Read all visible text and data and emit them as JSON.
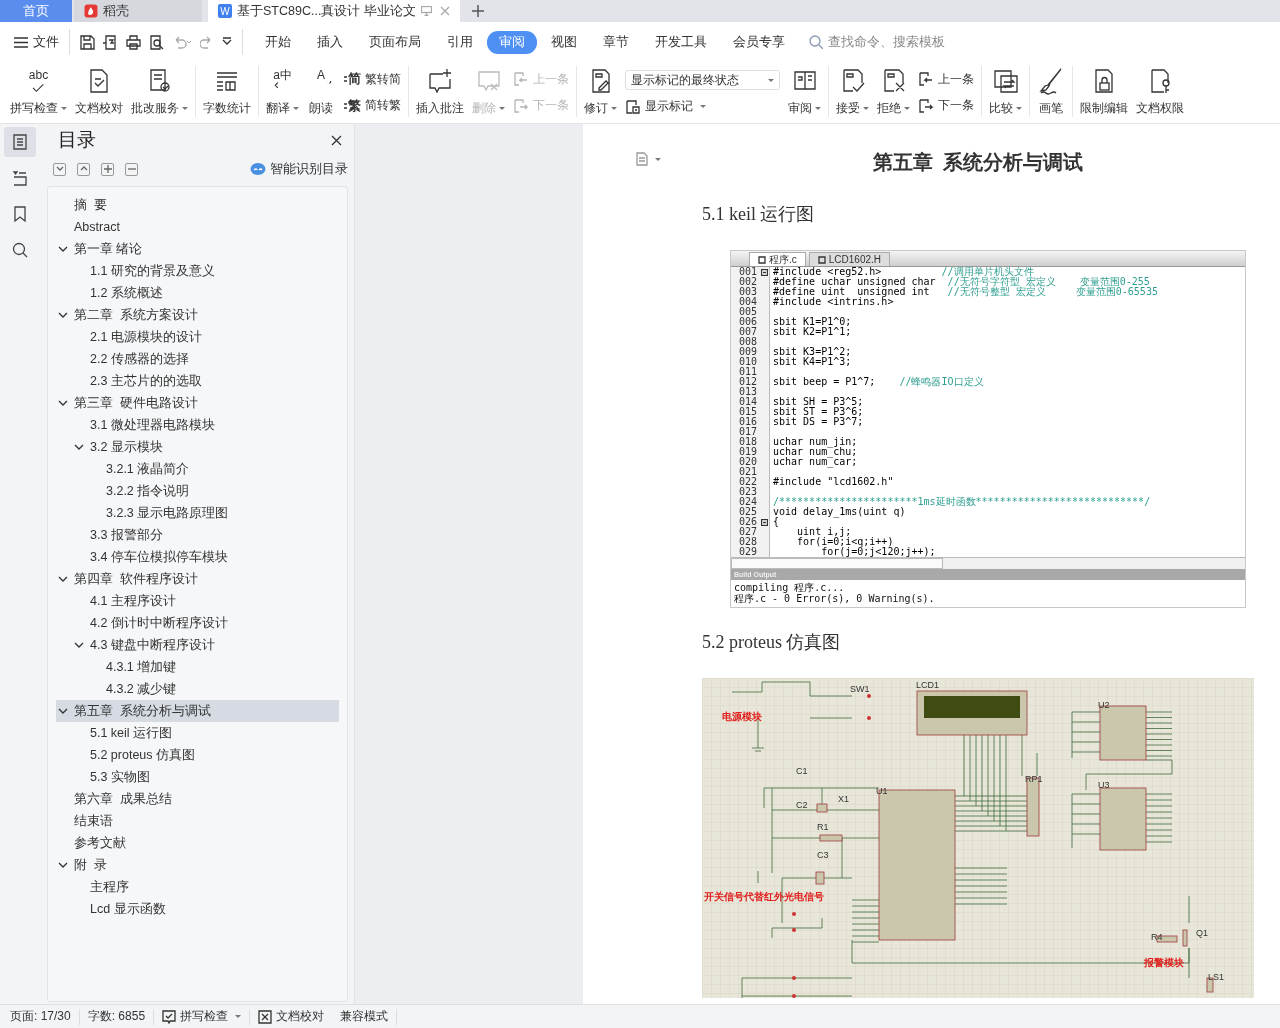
{
  "tabs": [
    {
      "label": "首页",
      "kind": "home",
      "selected": false
    },
    {
      "label": "稻壳",
      "kind": "docer",
      "selected": false
    },
    {
      "label": "基于STC89C...真设计 毕业论文",
      "kind": "document",
      "glyph": "W",
      "selected": true
    }
  ],
  "menu": {
    "file": "文件",
    "items": [
      {
        "label": "开始",
        "selected": false
      },
      {
        "label": "插入",
        "selected": false
      },
      {
        "label": "页面布局",
        "selected": false
      },
      {
        "label": "引用",
        "selected": false
      },
      {
        "label": "审阅",
        "selected": true
      },
      {
        "label": "视图",
        "selected": false
      },
      {
        "label": "章节",
        "selected": false
      },
      {
        "label": "开发工具",
        "selected": false
      },
      {
        "label": "会员专享",
        "selected": false
      }
    ],
    "search": {
      "placeholder": "查找命令、搜索模板"
    }
  },
  "ribbon": [
    {
      "kind": "large",
      "label": "拼写检查",
      "caret": true,
      "disabled": false,
      "glyph": "abc"
    },
    {
      "kind": "large",
      "label": "文档校对",
      "caret": false,
      "disabled": false
    },
    {
      "kind": "large",
      "label": "批改服务",
      "caret": true,
      "disabled": false
    },
    {
      "kind": "separator"
    },
    {
      "kind": "large",
      "label": "字数统计",
      "caret": false,
      "disabled": false
    },
    {
      "kind": "separator"
    },
    {
      "kind": "large",
      "label": "翻译",
      "caret": true,
      "disabled": false,
      "glyph": "a中"
    },
    {
      "kind": "large",
      "label": "朗读",
      "caret": false,
      "disabled": false,
      "glyph": "A"
    },
    {
      "kind": "pair",
      "items": [
        {
          "label": "繁转简",
          "glyph": "简",
          "disabled": false
        },
        {
          "label": "简转繁",
          "glyph": "繁",
          "disabled": false
        }
      ]
    },
    {
      "kind": "separator"
    },
    {
      "kind": "large",
      "label": "插入批注",
      "caret": false,
      "disabled": false
    },
    {
      "kind": "large",
      "label": "删除",
      "caret": true,
      "disabled": true
    },
    {
      "kind": "pair",
      "items": [
        {
          "label": "上一条",
          "disabled": true
        },
        {
          "label": "下一条",
          "disabled": true
        }
      ]
    },
    {
      "kind": "separator"
    },
    {
      "kind": "large",
      "label": "修订",
      "caret": true,
      "disabled": false
    },
    {
      "kind": "select",
      "value": "显示标记的最终状态",
      "below": {
        "label": "显示标记",
        "caret": true
      }
    },
    {
      "kind": "large",
      "label": "审阅",
      "caret": true,
      "disabled": false
    },
    {
      "kind": "separator"
    },
    {
      "kind": "large",
      "label": "接受",
      "caret": true,
      "disabled": false
    },
    {
      "kind": "large",
      "label": "拒绝",
      "caret": true,
      "disabled": false
    },
    {
      "kind": "pair",
      "items": [
        {
          "label": "上一条",
          "disabled": false
        },
        {
          "label": "下一条",
          "disabled": false
        }
      ]
    },
    {
      "kind": "separator"
    },
    {
      "kind": "large",
      "label": "比较",
      "caret": true,
      "disabled": false
    },
    {
      "kind": "separator"
    },
    {
      "kind": "large",
      "label": "画笔",
      "caret": false,
      "disabled": false
    },
    {
      "kind": "separator"
    },
    {
      "kind": "large",
      "label": "限制编辑",
      "caret": false,
      "disabled": false
    },
    {
      "kind": "large",
      "label": "文档权限",
      "caret": false,
      "disabled": false
    }
  ],
  "sidebar": {
    "rail": [
      {
        "selected": true
      },
      {
        "selected": false
      },
      {
        "selected": false
      },
      {
        "selected": false
      }
    ],
    "title": "目录",
    "smart_button": "智能识别目录",
    "items": [
      {
        "label": "摘  要",
        "selected": false
      },
      {
        "label": "Abstract",
        "selected": false
      },
      {
        "label": "第一章 绪论",
        "selected": false,
        "expanded": true,
        "children": [
          {
            "label": "1.1 研究的背景及意义",
            "selected": false
          },
          {
            "label": "1.2 系统概述",
            "selected": false
          }
        ]
      },
      {
        "label": "第二章  系统方案设计",
        "selected": false,
        "expanded": true,
        "children": [
          {
            "label": "2.1 电源模块的设计",
            "selected": false
          },
          {
            "label": "2.2 传感器的选择",
            "selected": false
          },
          {
            "label": "2.3 主芯片的的选取",
            "selected": false
          }
        ]
      },
      {
        "label": "第三章  硬件电路设计",
        "selected": false,
        "expanded": true,
        "children": [
          {
            "label": "3.1 微处理器电路模块",
            "selected": false
          },
          {
            "label": "3.2 显示模块",
            "selected": false,
            "expanded": true,
            "children": [
              {
                "label": "3.2.1 液晶简介",
                "selected": false
              },
              {
                "label": "3.2.2 指令说明",
                "selected": false
              },
              {
                "label": "3.2.3 显示电路原理图",
                "selected": false
              }
            ]
          },
          {
            "label": "3.3 报警部分",
            "selected": false
          },
          {
            "label": "3.4 停车位模拟停车模块",
            "selected": false
          }
        ]
      },
      {
        "label": "第四章  软件程序设计",
        "selected": false,
        "expanded": true,
        "children": [
          {
            "label": "4.1 主程序设计",
            "selected": false
          },
          {
            "label": "4.2 倒计时中断程序设计",
            "selected": false
          },
          {
            "label": "4.3 键盘中断程序设计",
            "selected": false,
            "expanded": true,
            "children": [
              {
                "label": "4.3.1 增加键",
                "selected": false
              },
              {
                "label": "4.3.2 减少键",
                "selected": false
              }
            ]
          }
        ]
      },
      {
        "label": "第五章  系统分析与调试",
        "selected": true,
        "expanded": true,
        "children": [
          {
            "label": "5.1 keil 运行图",
            "selected": false
          },
          {
            "label": "5.2 proteus 仿真图",
            "selected": false
          },
          {
            "label": "5.3 实物图",
            "selected": false
          }
        ]
      },
      {
        "label": "第六章  成果总结",
        "selected": false
      },
      {
        "label": "结束语",
        "selected": false
      },
      {
        "label": "参考文献",
        "selected": false
      },
      {
        "label": "附  录",
        "selected": false,
        "expanded": true,
        "children": [
          {
            "label": "主程序",
            "selected": false
          },
          {
            "label": "Lcd 显示函数",
            "selected": false
          }
        ]
      }
    ]
  },
  "document": {
    "title": "第五章  系统分析与调试",
    "sections": [
      {
        "kind": "code_window",
        "heading": "5.1 keil 运行图",
        "window": {
          "tabs": [
            {
              "label": "程序.c",
              "selected": true
            },
            {
              "label": "LCD1602.H",
              "selected": false
            }
          ],
          "lines": [
            {
              "no": "001",
              "code": "#include <reg52.h>          ",
              "comment": "//调用单片机头文件",
              "fold": true
            },
            {
              "no": "002",
              "code": "#define uchar unsigned char  ",
              "comment": "//无符号字符型 宏定义    变量范围0-255"
            },
            {
              "no": "003",
              "code": "#define uint  unsigned int   ",
              "comment": "//无符号整型 宏定义     变量范围0-65535"
            },
            {
              "no": "004",
              "code": "#include <intrins.h>"
            },
            {
              "no": "005"
            },
            {
              "no": "006",
              "code": "sbit K1=P1^0;"
            },
            {
              "no": "007",
              "code": "sbit K2=P1^1;"
            },
            {
              "no": "008"
            },
            {
              "no": "009",
              "code": "sbit K3=P1^2;"
            },
            {
              "no": "010",
              "code": "sbit K4=P1^3;"
            },
            {
              "no": "011"
            },
            {
              "no": "012",
              "code": "sbit beep = P1^7;    ",
              "comment": "//蜂鸣器IO口定义"
            },
            {
              "no": "013"
            },
            {
              "no": "014",
              "code": "sbit SH = P3^5;"
            },
            {
              "no": "015",
              "code": "sbit ST = P3^6;"
            },
            {
              "no": "016",
              "code": "sbit DS = P3^7;"
            },
            {
              "no": "017"
            },
            {
              "no": "018",
              "code": "uchar num_jin;"
            },
            {
              "no": "019",
              "code": "uchar num_chu;"
            },
            {
              "no": "020",
              "code": "uchar num_car;"
            },
            {
              "no": "021"
            },
            {
              "no": "022",
              "code": "#include \"lcd1602.h\""
            },
            {
              "no": "023"
            },
            {
              "no": "024",
              "comment": "/***********************1ms延时函数****************************/"
            },
            {
              "no": "025",
              "code": "void delay_1ms(uint q)"
            },
            {
              "no": "026",
              "code": "{",
              "fold": true
            },
            {
              "no": "027",
              "code": "    uint i,j;"
            },
            {
              "no": "028",
              "code": "    for(i=0;i<q;i++)"
            },
            {
              "no": "029",
              "code": "        for(j=0;j<120;j++);"
            }
          ],
          "output_title": "Build Output",
          "output": [
            "compiling 程序.c...",
            "程序.c - 0 Error(s), 0 Warning(s)."
          ]
        }
      },
      {
        "kind": "schematic",
        "heading": "5.2 proteus 仿真图",
        "labels": [
          {
            "text": "SW1",
            "kind": "ref"
          },
          {
            "text": "LCD1",
            "kind": "ref"
          },
          {
            "text": "电源模块",
            "kind": "module"
          },
          {
            "text": "C1",
            "kind": "ref"
          },
          {
            "text": "C2",
            "kind": "ref"
          },
          {
            "text": "X1",
            "kind": "ref"
          },
          {
            "text": "U1",
            "kind": "ref"
          },
          {
            "text": "R1",
            "kind": "ref"
          },
          {
            "text": "C3",
            "kind": "ref"
          },
          {
            "text": "RP1",
            "kind": "ref"
          },
          {
            "text": "U2",
            "kind": "ref"
          },
          {
            "text": "U3",
            "kind": "ref"
          },
          {
            "text": "开关信号代替红外光电信号",
            "kind": "module"
          },
          {
            "text": "R4",
            "kind": "ref"
          },
          {
            "text": "Q1",
            "kind": "ref"
          },
          {
            "text": "报警模块",
            "kind": "module"
          },
          {
            "text": "LS1",
            "kind": "ref"
          }
        ]
      }
    ]
  },
  "status_bar": {
    "page": "页面: 17/30",
    "words": "字数: 6855",
    "spell": "拼写检查",
    "proofread": "文档校对",
    "mode": "兼容模式"
  }
}
